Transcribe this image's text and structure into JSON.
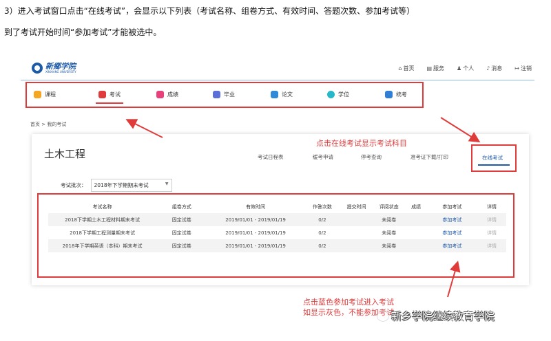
{
  "instructions": {
    "line1": "3）进入考试窗口点击“在线考试”，会显示以下列表（考试名称、组卷方式、有效时间、答题次数、参加考试等）",
    "line2": "到了考试开始时间“参加考试”才能被选中。"
  },
  "header": {
    "logo_cn": "新鄉学院",
    "logo_en": "XINXIANG UNIVERSITY",
    "topnav": [
      {
        "icon": "home-icon",
        "label": "首页"
      },
      {
        "icon": "service-icon",
        "label": "服务"
      },
      {
        "icon": "person-icon",
        "label": "个人"
      },
      {
        "icon": "bell-icon",
        "label": "消息"
      },
      {
        "icon": "logout-icon",
        "label": "注销"
      }
    ]
  },
  "modules": [
    {
      "label": "课程",
      "color": "#f5a623",
      "active": false
    },
    {
      "label": "考试",
      "color": "#e03b3b",
      "active": true
    },
    {
      "label": "成绩",
      "color": "#e8407a",
      "active": false
    },
    {
      "label": "毕业",
      "color": "#5b6fd6",
      "active": false
    },
    {
      "label": "论文",
      "color": "#2e8ad8",
      "active": false
    },
    {
      "label": "学位",
      "color": "#26b8c8",
      "active": false
    },
    {
      "label": "统考",
      "color": "#2f7fd6",
      "active": false
    }
  ],
  "breadcrumb": "首页 > 我的考试",
  "card": {
    "title": "土木工程",
    "subtabs": [
      "考试日程表",
      "缓考申请",
      "停考查询",
      "准考证下载/打印"
    ],
    "online_tab": "在线考试",
    "batch_label": "考试批次：",
    "batch_value": "2018年下学期期末考试"
  },
  "annotations": {
    "a1": "点击在线考试显示考试科目",
    "a2_line1": "点击蓝色参加考试进入考试",
    "a2_line2": "如显示灰色，不能参加考试"
  },
  "table": {
    "headers": [
      "考试名称",
      "组卷方式",
      "有效时间",
      "作答次数",
      "提交时间",
      "评阅状态",
      "成绩",
      "参加考试",
      "详情"
    ],
    "rows": [
      [
        "2018下学期土木工程材料期末考试",
        "固定试卷",
        "2019/01/01 - 2019/01/19",
        "0/2",
        "",
        "未阅卷",
        "",
        "参加考试",
        "详情"
      ],
      [
        "2018下学期工程测量期末考试",
        "固定试卷",
        "2019/01/01 - 2019/01/19",
        "0/2",
        "",
        "未阅卷",
        "",
        "参加考试",
        "详情"
      ],
      [
        "2018年下学期英语（本科）期末考试",
        "固定试卷",
        "2019/01/01 - 2019/01/19",
        "0/2",
        "",
        "未阅卷",
        "",
        "参加考试",
        "详情"
      ]
    ]
  },
  "watermark": "新乡学院继续教育学院",
  "colors": {
    "accent": "#1f5aa8",
    "highlight": "#e03b3b"
  }
}
